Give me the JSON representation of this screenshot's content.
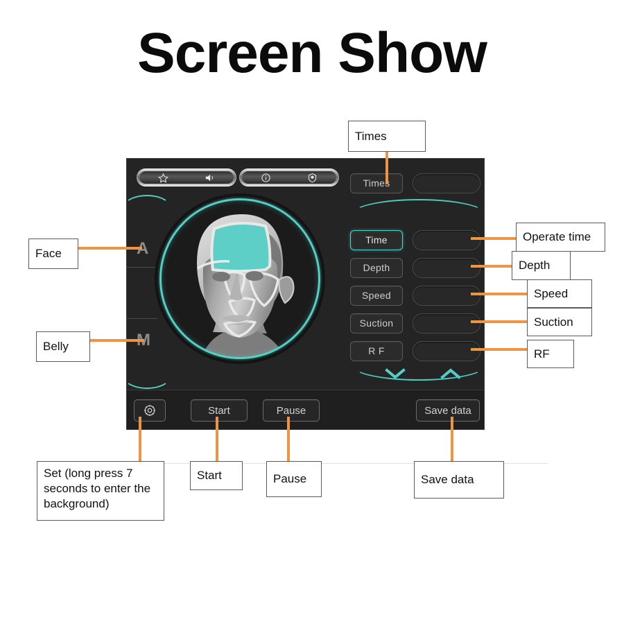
{
  "page": {
    "title": "Screen Show",
    "accent_teal": "#55cfc5",
    "connector_orange": "#ef9443",
    "panel_background": "#232323"
  },
  "device": {
    "status_toolbar": {
      "icons": [
        "star-icon",
        "volume-icon",
        "info-icon",
        "shield-location-icon"
      ]
    },
    "mode_rail": {
      "labels": [
        "A",
        "M"
      ]
    },
    "head_dial": {
      "highlight_region": "forehead",
      "highlight_color": "#5ecfc6"
    },
    "parameters": [
      {
        "key": "times",
        "label": "Times",
        "value": "",
        "active": false
      },
      {
        "key": "time",
        "label": "Time",
        "value": "",
        "active": true
      },
      {
        "key": "depth",
        "label": "Depth",
        "value": "",
        "active": false
      },
      {
        "key": "speed",
        "label": "Speed",
        "value": "",
        "active": false
      },
      {
        "key": "suction",
        "label": "Suction",
        "value": "",
        "active": false
      },
      {
        "key": "rf",
        "label": "R F",
        "value": "",
        "active": false
      }
    ],
    "steppers": {
      "down_icon": "chevron-down-icon",
      "up_icon": "chevron-up-icon"
    },
    "actions": {
      "set_icon": "gear-icon",
      "start_label": "Start",
      "pause_label": "Pause",
      "save_data_label": "Save data"
    }
  },
  "annotations": {
    "times": "Times",
    "face": "Face",
    "belly": "Belly",
    "operate_time": "Operate time",
    "depth": "Depth",
    "speed": "Speed",
    "suction": "Suction",
    "rf": "RF",
    "set": "Set (long press 7 seconds to enter the background)",
    "start": "Start",
    "pause": "Pause",
    "save_data": "Save data"
  }
}
